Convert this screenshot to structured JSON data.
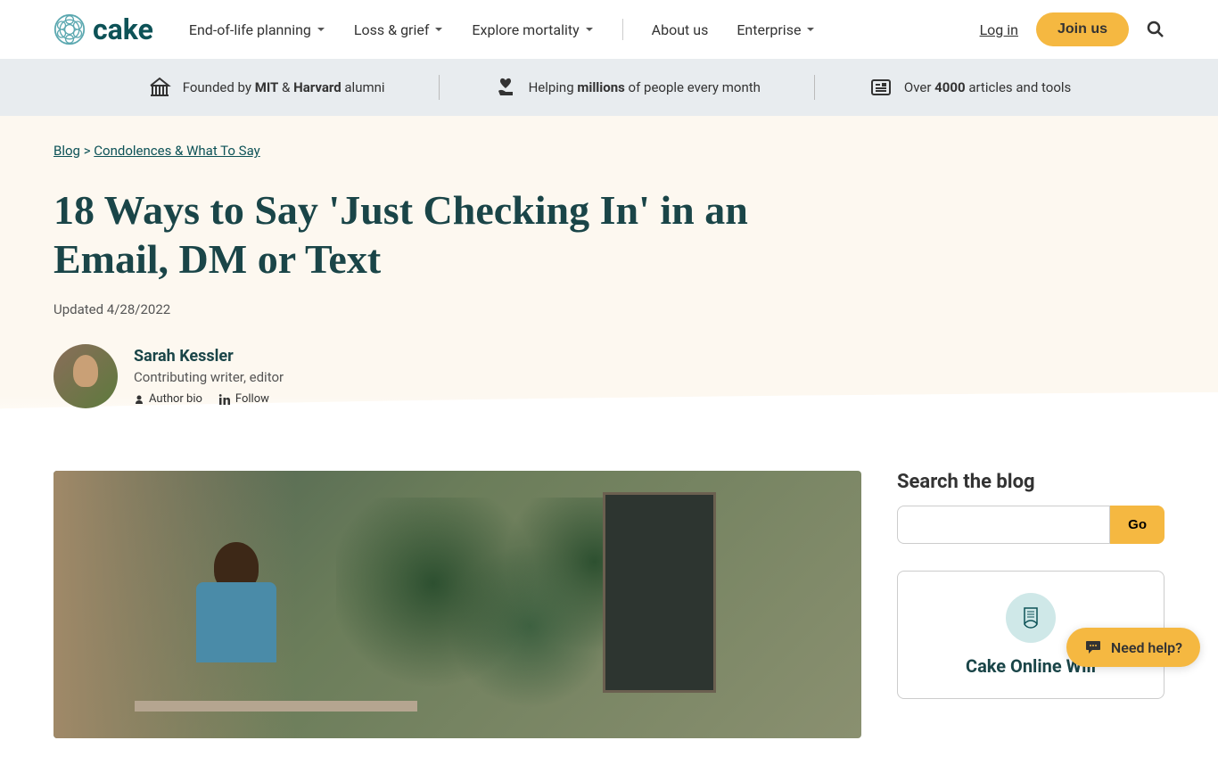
{
  "header": {
    "logo_text": "cake",
    "nav": [
      {
        "label": "End-of-life planning",
        "has_dropdown": true
      },
      {
        "label": "Loss & grief",
        "has_dropdown": true
      },
      {
        "label": "Explore mortality",
        "has_dropdown": true
      },
      {
        "label": "About us",
        "has_dropdown": false
      },
      {
        "label": "Enterprise",
        "has_dropdown": true
      }
    ],
    "login": "Log in",
    "join": "Join us"
  },
  "trust": [
    {
      "prefix": "Founded by ",
      "bold1": "MIT",
      "mid": " & ",
      "bold2": "Harvard",
      "suffix": " alumni"
    },
    {
      "prefix": "Helping ",
      "bold1": "millions",
      "suffix": " of people every month"
    },
    {
      "prefix": "Over ",
      "bold1": "4000",
      "suffix": " articles and tools"
    }
  ],
  "breadcrumb": {
    "item1": "Blog",
    "sep": " > ",
    "item2": "Condolences & What To Say"
  },
  "article": {
    "title": "18 Ways to Say 'Just Checking In' in an Email, DM or Text",
    "updated": "Updated 4/28/2022",
    "author": {
      "name": "Sarah Kessler",
      "role": "Contributing writer, editor",
      "bio_label": "Author bio",
      "follow_label": "Follow"
    }
  },
  "sidebar": {
    "search_title": "Search the blog",
    "go_label": "Go",
    "card_title": "Cake Online Will"
  },
  "help": "Need help?"
}
